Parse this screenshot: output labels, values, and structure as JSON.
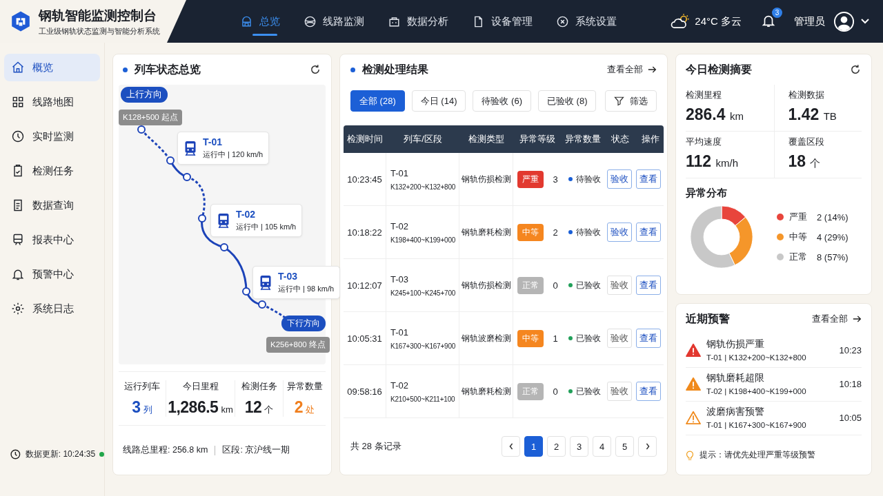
{
  "header": {
    "title": "钢轨智能监测控制台",
    "subtitle": "工业级钢轨状态监测与智能分析系统",
    "nav": [
      {
        "label": "总览",
        "selected": true
      },
      {
        "label": "线路监测",
        "selected": false
      },
      {
        "label": "数据分析",
        "selected": false
      },
      {
        "label": "设备管理",
        "selected": false
      },
      {
        "label": "系统设置",
        "selected": false
      }
    ],
    "weather": "24°C 多云",
    "notifications": "3",
    "user": "管理员"
  },
  "sidebar": {
    "items": [
      {
        "label": "概览",
        "selected": true
      },
      {
        "label": "线路地图",
        "selected": false
      },
      {
        "label": "实时监测",
        "selected": false
      },
      {
        "label": "检测任务",
        "selected": false
      },
      {
        "label": "数据查询",
        "selected": false
      },
      {
        "label": "报表中心",
        "selected": false
      },
      {
        "label": "预警中心",
        "selected": false
      },
      {
        "label": "系统日志",
        "selected": false
      }
    ],
    "update": "数据更新: 10:24:35",
    "online": true
  },
  "train_panel": {
    "title": "列车状态总览",
    "map": {
      "up_label": "上行方向",
      "down_label": "下行方向",
      "start": "K128+500 起点",
      "end": "K256+800 终点",
      "trains": [
        {
          "name": "T-01",
          "status": "运行中 | 120 km/h"
        },
        {
          "name": "T-02",
          "status": "运行中 | 105 km/h"
        },
        {
          "name": "T-03",
          "status": "运行中 | 98 km/h"
        }
      ]
    },
    "stats": [
      {
        "label": "运行列车",
        "value": "3",
        "unit": "列",
        "color": "#1c4fc0"
      },
      {
        "label": "今日里程",
        "value": "1,286.5",
        "unit": "km",
        "color": "#1d1f24"
      },
      {
        "label": "检测任务",
        "value": "12",
        "unit": "个",
        "color": "#1d1f24"
      },
      {
        "label": "异常数量",
        "value": "2",
        "unit": "处",
        "color": "#f07f1e"
      }
    ],
    "footer": [
      "线路总里程: 256.8 km",
      "区段: 京沪线一期"
    ]
  },
  "results": {
    "title": "检测处理结果",
    "view_all": "查看全部",
    "filters": [
      {
        "label": "全部 (28)",
        "selected": true
      },
      {
        "label": "今日 (14)",
        "selected": false
      },
      {
        "label": "待验收 (6)",
        "selected": false
      },
      {
        "label": "已验收 (8)",
        "selected": false
      }
    ],
    "filter_button": "筛选",
    "columns": [
      "检测时间",
      "列车/区段",
      "检测类型",
      "异常等级",
      "异常数量",
      "状态",
      "操作"
    ],
    "rows": [
      {
        "time": "10:23:45",
        "train": "T-01",
        "section": "K132+200~K132+800",
        "type": "钢轨伤损检测",
        "level": {
          "label": "严重",
          "kind": "severe"
        },
        "count": "3",
        "status": {
          "label": "待验收",
          "color": "#1a5fd6"
        },
        "accept": {
          "label": "验收",
          "disabled": false
        },
        "view": "查看"
      },
      {
        "time": "10:18:22",
        "train": "T-02",
        "section": "K198+400~K199+000",
        "type": "钢轨磨耗检测",
        "level": {
          "label": "中等",
          "kind": "medium"
        },
        "count": "2",
        "status": {
          "label": "待验收",
          "color": "#1a5fd6"
        },
        "accept": {
          "label": "验收",
          "disabled": false
        },
        "view": "查看"
      },
      {
        "time": "10:12:07",
        "train": "T-03",
        "section": "K245+100~K245+700",
        "type": "钢轨伤损检测",
        "level": {
          "label": "正常",
          "kind": "normal"
        },
        "count": "0",
        "status": {
          "label": "已验收",
          "color": "#22a05a"
        },
        "accept": {
          "label": "验收",
          "disabled": true
        },
        "view": "查看"
      },
      {
        "time": "10:05:31",
        "train": "T-01",
        "section": "K167+300~K167+900",
        "type": "钢轨波磨检测",
        "level": {
          "label": "中等",
          "kind": "medium"
        },
        "count": "1",
        "status": {
          "label": "已验收",
          "color": "#22a05a"
        },
        "accept": {
          "label": "验收",
          "disabled": true
        },
        "view": "查看"
      },
      {
        "time": "09:58:16",
        "train": "T-02",
        "section": "K210+500~K211+100",
        "type": "钢轨磨耗检测",
        "level": {
          "label": "正常",
          "kind": "normal"
        },
        "count": "0",
        "status": {
          "label": "已验收",
          "color": "#22a05a"
        },
        "accept": {
          "label": "验收",
          "disabled": true
        },
        "view": "查看"
      }
    ],
    "total": "共 28 条记录",
    "pages": [
      {
        "label": "1",
        "selected": true
      },
      {
        "label": "2",
        "selected": false
      },
      {
        "label": "3",
        "selected": false
      },
      {
        "label": "4",
        "selected": false
      },
      {
        "label": "5",
        "selected": false
      }
    ]
  },
  "summary": {
    "title": "今日检测摘要",
    "metrics": [
      {
        "label": "检测里程",
        "value": "286.4",
        "unit": "km"
      },
      {
        "label": "检测数据",
        "value": "1.42",
        "unit": "TB"
      },
      {
        "label": "平均速度",
        "value": "112",
        "unit": "km/h"
      },
      {
        "label": "覆盖区段",
        "value": "18",
        "unit": "个"
      }
    ],
    "chart_data": {
      "type": "donut",
      "title": "异常分布",
      "categories": [
        "严重",
        "中等",
        "正常"
      ],
      "values": [
        14,
        29,
        57
      ],
      "legend": "right"
    },
    "legend": [
      {
        "value": "2 (14%)",
        "color": "#e8453c"
      },
      {
        "value": "4 (29%)",
        "color": "#f5962a"
      },
      {
        "value": "8 (57%)",
        "color": "#c8c8c8"
      }
    ]
  },
  "alerts": {
    "title": "近期预警",
    "view_all": "查看全部",
    "items": [
      {
        "kind": "severe",
        "title": "钢轨伤损严重",
        "detail": "T-01 | K132+200~K132+800",
        "time": "10:23"
      },
      {
        "kind": "warning",
        "title": "钢轨磨耗超限",
        "detail": "T-02 | K198+400~K199+000",
        "time": "10:18"
      },
      {
        "kind": "notice",
        "title": "波磨病害预警",
        "detail": "T-01 | K167+300~K167+900",
        "time": "10:05"
      }
    ],
    "tip": "提示：请优先处理严重等级预警"
  }
}
